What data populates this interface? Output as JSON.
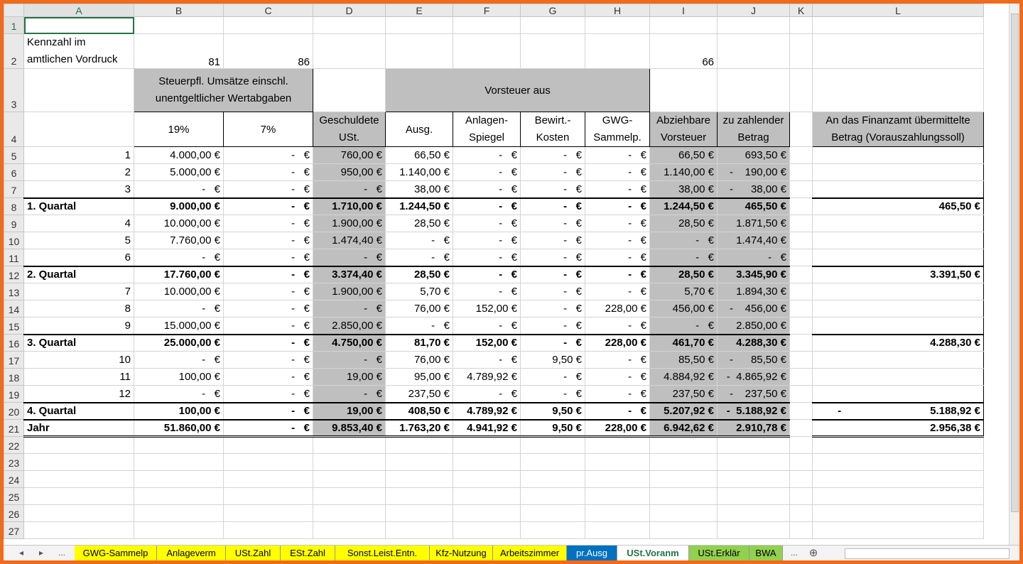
{
  "columns": [
    "A",
    "B",
    "C",
    "D",
    "E",
    "F",
    "G",
    "H",
    "I",
    "J",
    "K",
    "L"
  ],
  "row2": {
    "a1": "Kennzahl im",
    "a2": "amtlichen Vordruck",
    "b": "81",
    "c": "86",
    "i": "66"
  },
  "header3": {
    "bc1": "Steuerpfl. Umsätze einschl.",
    "bc2": "unentgeltlicher Wertabgaben",
    "vorsteuer": "Vorsteuer aus"
  },
  "header4": {
    "b": "19%",
    "c": "7%",
    "d1": "Geschuldete",
    "d2": "USt.",
    "e": "Ausg.",
    "f1": "Anlagen-",
    "f2": "Spiegel",
    "g1": "Bewirt.-",
    "g2": "Kosten",
    "h1": "GWG-",
    "h2": "Sammelp.",
    "i1": "Abziehbare",
    "i2": "Vorsteuer",
    "j1": "zu zahlender",
    "j2": "Betrag",
    "l1": "An das Finanzamt übermittelte",
    "l2": "Betrag (Vorauszahlungssoll)"
  },
  "rows": [
    {
      "n": 5,
      "a": "1",
      "b": "4.000,00 €",
      "c": "-   €",
      "d": "760,00 €",
      "e": "66,50 €",
      "f": "-   €",
      "g": "-   €",
      "h": "-   €",
      "i": "66,50 €",
      "j": "693,50 €",
      "l": ""
    },
    {
      "n": 6,
      "a": "2",
      "b": "5.000,00 €",
      "c": "-   €",
      "d": "950,00 €",
      "e": "1.140,00 €",
      "f": "-   €",
      "g": "-   €",
      "h": "-   €",
      "i": "1.140,00 €",
      "j": "-    190,00 €",
      "l": ""
    },
    {
      "n": 7,
      "a": "3",
      "b": "-   €",
      "c": "-   €",
      "d": "-   €",
      "e": "38,00 €",
      "f": "-   €",
      "g": "-   €",
      "h": "-   €",
      "i": "38,00 €",
      "j": "-      38,00 €",
      "l": ""
    },
    {
      "n": 8,
      "a": "1. Quartal",
      "b": "9.000,00 €",
      "c": "-   €",
      "d": "1.710,00 €",
      "e": "1.244,50 €",
      "f": "-   €",
      "g": "-   €",
      "h": "-   €",
      "i": "1.244,50 €",
      "j": "465,50 €",
      "l": "465,50 €",
      "bold": true
    },
    {
      "n": 9,
      "a": "4",
      "b": "10.000,00 €",
      "c": "-   €",
      "d": "1.900,00 €",
      "e": "28,50 €",
      "f": "-   €",
      "g": "-   €",
      "h": "-   €",
      "i": "28,50 €",
      "j": "1.871,50 €",
      "l": ""
    },
    {
      "n": 10,
      "a": "5",
      "b": "7.760,00 €",
      "c": "-   €",
      "d": "1.474,40 €",
      "e": "-   €",
      "f": "-   €",
      "g": "-   €",
      "h": "-   €",
      "i": "-   €",
      "j": "1.474,40 €",
      "l": ""
    },
    {
      "n": 11,
      "a": "6",
      "b": "-   €",
      "c": "-   €",
      "d": "-   €",
      "e": "-   €",
      "f": "-   €",
      "g": "-   €",
      "h": "-   €",
      "i": "-   €",
      "j": "-   €",
      "l": ""
    },
    {
      "n": 12,
      "a": "2. Quartal",
      "b": "17.760,00 €",
      "c": "-   €",
      "d": "3.374,40 €",
      "e": "28,50 €",
      "f": "-   €",
      "g": "-   €",
      "h": "-   €",
      "i": "28,50 €",
      "j": "3.345,90 €",
      "l": "3.391,50 €",
      "bold": true
    },
    {
      "n": 13,
      "a": "7",
      "b": "10.000,00 €",
      "c": "-   €",
      "d": "1.900,00 €",
      "e": "5,70 €",
      "f": "-   €",
      "g": "-   €",
      "h": "-   €",
      "i": "5,70 €",
      "j": "1.894,30 €",
      "l": ""
    },
    {
      "n": 14,
      "a": "8",
      "b": "-   €",
      "c": "-   €",
      "d": "-   €",
      "e": "76,00 €",
      "f": "152,00 €",
      "g": "-   €",
      "h": "228,00 €",
      "i": "456,00 €",
      "j": "-    456,00 €",
      "l": ""
    },
    {
      "n": 15,
      "a": "9",
      "b": "15.000,00 €",
      "c": "-   €",
      "d": "2.850,00 €",
      "e": "-   €",
      "f": "-   €",
      "g": "-   €",
      "h": "-   €",
      "i": "-   €",
      "j": "2.850,00 €",
      "l": ""
    },
    {
      "n": 16,
      "a": "3. Quartal",
      "b": "25.000,00 €",
      "c": "-   €",
      "d": "4.750,00 €",
      "e": "81,70 €",
      "f": "152,00 €",
      "g": "-   €",
      "h": "228,00 €",
      "i": "461,70 €",
      "j": "4.288,30 €",
      "l": "4.288,30 €",
      "bold": true
    },
    {
      "n": 17,
      "a": "10",
      "b": "-   €",
      "c": "-   €",
      "d": "-   €",
      "e": "76,00 €",
      "f": "-   €",
      "g": "9,50 €",
      "h": "-   €",
      "i": "85,50 €",
      "j": "-      85,50 €",
      "l": ""
    },
    {
      "n": 18,
      "a": "11",
      "b": "100,00 €",
      "c": "-   €",
      "d": "19,00 €",
      "e": "95,00 €",
      "f": "4.789,92 €",
      "g": "-   €",
      "h": "-   €",
      "i": "4.884,92 €",
      "j": "-  4.865,92 €",
      "l": ""
    },
    {
      "n": 19,
      "a": "12",
      "b": "-   €",
      "c": "-   €",
      "d": "-   €",
      "e": "237,50 €",
      "f": "-   €",
      "g": "-   €",
      "h": "-   €",
      "i": "237,50 €",
      "j": "-    237,50 €",
      "l": ""
    },
    {
      "n": 20,
      "a": "4. Quartal",
      "b": "100,00 €",
      "c": "-   €",
      "d": "19,00 €",
      "e": "408,50 €",
      "f": "4.789,92 €",
      "g": "9,50 €",
      "h": "-   €",
      "i": "5.207,92 €",
      "j": "-  5.188,92 €",
      "l": "-                              5.188,92 €",
      "bold": true
    },
    {
      "n": 21,
      "a": "Jahr",
      "b": "51.860,00 €",
      "c": "-   €",
      "d": "9.853,40 €",
      "e": "1.763,20 €",
      "f": "4.941,92 €",
      "g": "9,50 €",
      "h": "228,00 €",
      "i": "6.942,62 €",
      "j": "2.910,78 €",
      "l": "2.956,38 €",
      "bold": true
    }
  ],
  "empty_rows": [
    22,
    23,
    24,
    25,
    26,
    27
  ],
  "tabs": [
    {
      "label": "GWG-Sammelp",
      "color": "#ffff00"
    },
    {
      "label": "Anlageverm",
      "color": "#ffff00"
    },
    {
      "label": "USt.Zahl",
      "color": "#ffff00"
    },
    {
      "label": "ESt.Zahl",
      "color": "#ffff00"
    },
    {
      "label": "Sonst.Leist.Entn.",
      "color": "#ffff00"
    },
    {
      "label": "Kfz-Nutzung",
      "color": "#ffff00"
    },
    {
      "label": "Arbeitszimmer",
      "color": "#ffff00"
    },
    {
      "label": "pr.Ausg",
      "color": "#0070c0"
    },
    {
      "label": "USt.Voranm",
      "color": "#ffffff",
      "active": true
    },
    {
      "label": "USt.Erklär",
      "color": "#92d050"
    },
    {
      "label": "BWA",
      "color": "#92d050"
    }
  ],
  "nav": {
    "prev": "◂",
    "next": "▸",
    "more": "...",
    "more_right": "...",
    "add": "⊕"
  }
}
